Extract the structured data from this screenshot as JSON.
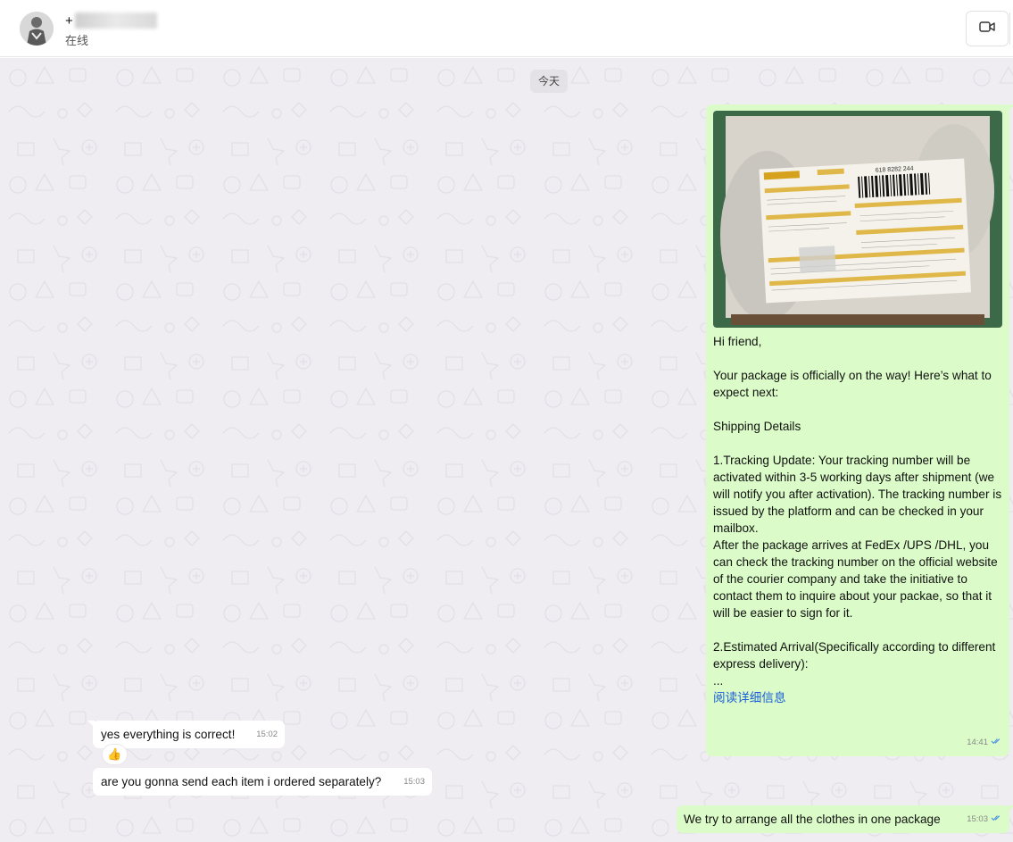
{
  "header": {
    "contact_prefix": "+",
    "status": "在线",
    "video_icon": "video-camera-icon"
  },
  "chat": {
    "date_divider": "今天",
    "messages": [
      {
        "direction": "out",
        "text": "Hi friend,\n\nYour package is officially on the way!  Here’s what to expect next:\n\nShipping Details\n\n1.Tracking Update: Your tracking number will be activated within 3-5 working days after shipment (we will notify you after activation). The tracking number is issued by the platform and can be checked in your mailbox.\nAfter the package arrives at FedEx /UPS /DHL, you can check the tracking number on the official website of the courier company and take the initiative to contact them to inquire about your packae, so that it will be easier to sign for it.\n\n2.Estimated Arrival(Specifically according to different express delivery):\n...",
        "read_more": "阅读详细信息",
        "time": "14:41",
        "photo_label": "618 8282 244"
      },
      {
        "direction": "in",
        "text": "yes everything is correct!",
        "time": "15:02",
        "reaction": "👍"
      },
      {
        "direction": "in",
        "text": "are you gonna send each item i ordered separately?",
        "time": "15:03"
      },
      {
        "direction": "out",
        "text": "We try to arrange all the clothes in one package",
        "time": "15:03"
      }
    ]
  },
  "colors": {
    "outgoing_bubble": "#dbfcc8",
    "incoming_bubble": "#ffffff",
    "chat_background": "#efedf2",
    "read_tick": "#4a90e2",
    "link": "#1a5ed8"
  }
}
